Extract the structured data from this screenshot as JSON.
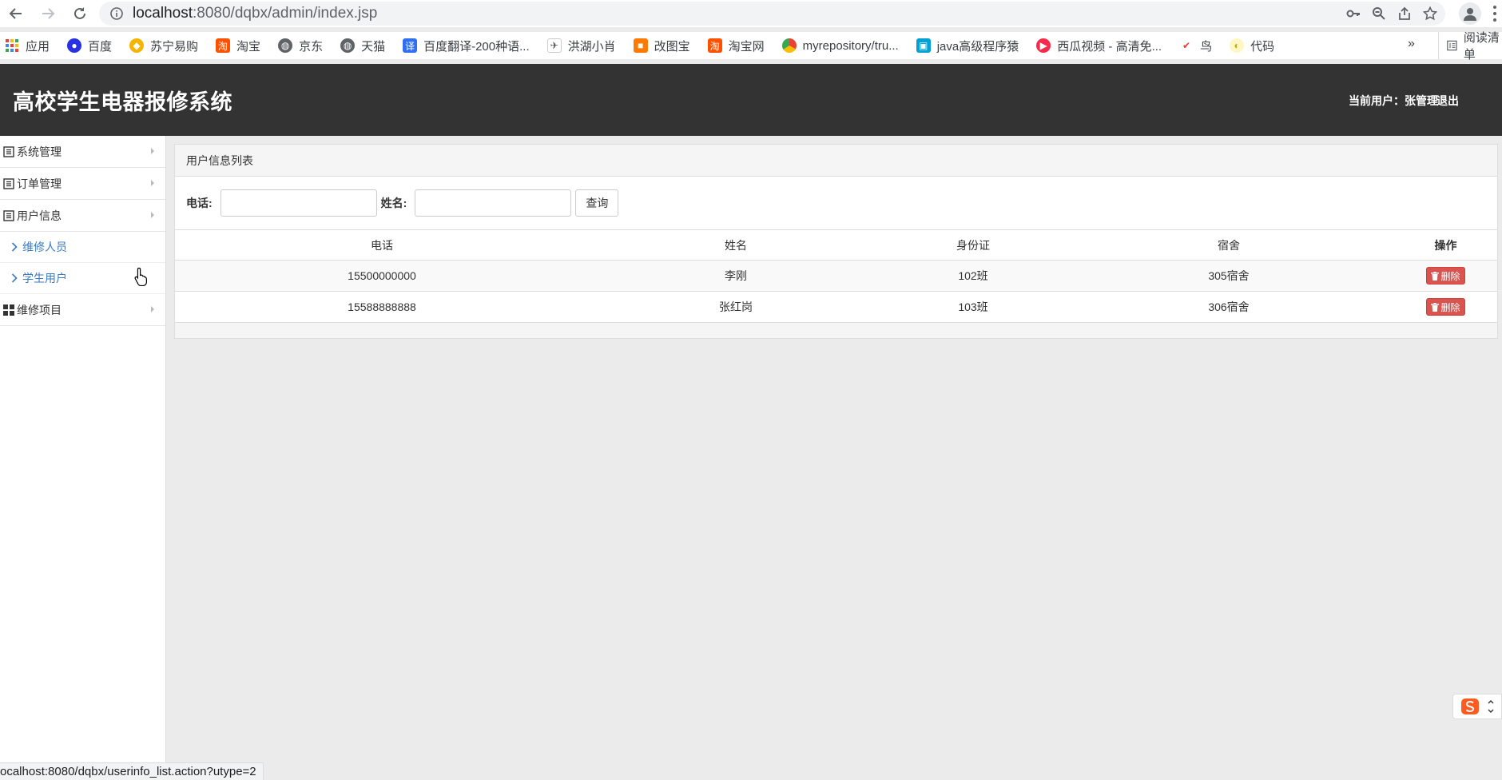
{
  "browser": {
    "url_host": "localhost",
    "url_path": ":8080/dqbx/admin/index.jsp",
    "bookmarks": [
      {
        "label": "应用",
        "icon": "apps-grid-icon"
      },
      {
        "label": "百度",
        "icon": "baidu-paw-icon"
      },
      {
        "label": "苏宁易购",
        "icon": "suning-icon"
      },
      {
        "label": "淘宝",
        "icon": "taobao-icon"
      },
      {
        "label": "京东",
        "icon": "globe-icon"
      },
      {
        "label": "天猫",
        "icon": "globe-icon"
      },
      {
        "label": "百度翻译-200种语...",
        "icon": "translate-icon"
      },
      {
        "label": "洪湖小肖",
        "icon": "bird-icon"
      },
      {
        "label": "改图宝",
        "icon": "image-tool-icon"
      },
      {
        "label": "淘宝网",
        "icon": "taobao-icon"
      },
      {
        "label": "myrepository/tru...",
        "icon": "chrome-icon"
      },
      {
        "label": "java高级程序猿",
        "icon": "bilibili-icon"
      },
      {
        "label": "西瓜视频 - 高清免...",
        "icon": "xigua-icon"
      },
      {
        "label": "鸟",
        "icon": "bird-red-icon"
      },
      {
        "label": "代码",
        "icon": "code-icon"
      }
    ],
    "more_label": "»",
    "reading_list_label": "阅读清单",
    "status_url": "ocalhost:8080/dqbx/userinfo_list.action?utype=2"
  },
  "header": {
    "title": "高校学生电器报修系统",
    "current_user_label": "当前用户：张管理",
    "logout_label": "退出"
  },
  "sidebar": {
    "items": [
      {
        "label": "系统管理"
      },
      {
        "label": "订单管理"
      },
      {
        "label": "用户信息"
      },
      {
        "label": "维修项目"
      }
    ],
    "sub_items": [
      {
        "label": "维修人员"
      },
      {
        "label": "学生用户"
      }
    ]
  },
  "panel": {
    "title": "用户信息列表",
    "search": {
      "phone_label": "电话:",
      "name_label": "姓名:",
      "phone_value": "",
      "name_value": "",
      "query_label": "查询"
    },
    "columns": [
      "电话",
      "姓名",
      "身份证",
      "宿舍",
      "操作"
    ],
    "rows": [
      {
        "phone": "15500000000",
        "name": "李刚",
        "id_card": "102班",
        "dorm": "305宿舍",
        "action": "删除"
      },
      {
        "phone": "15588888888",
        "name": "张红岗",
        "id_card": "103班",
        "dorm": "306宿舍",
        "action": "删除"
      }
    ]
  },
  "colors": {
    "header_bg": "#333333",
    "link_blue": "#3a7abf",
    "danger": "#d9534f"
  }
}
